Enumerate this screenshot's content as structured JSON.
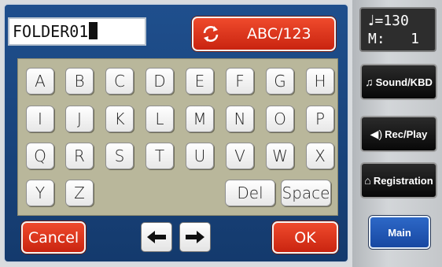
{
  "name_field": {
    "value": "FOLDER01"
  },
  "mode_button": {
    "label": "ABC/123",
    "icon": "cycle-arrows-icon"
  },
  "keyboard": {
    "rows": [
      [
        "A",
        "B",
        "C",
        "D",
        "E",
        "F",
        "G",
        "H"
      ],
      [
        "I",
        "J",
        "K",
        "L",
        "M",
        "N",
        "O",
        "P"
      ],
      [
        "Q",
        "R",
        "S",
        "T",
        "U",
        "V",
        "W",
        "X"
      ],
      [
        "Y",
        "Z"
      ]
    ],
    "del_label": "Del",
    "space_label": "Space"
  },
  "bottom_bar": {
    "cancel_label": "Cancel",
    "ok_label": "OK",
    "left_arrow": "🡐",
    "right_arrow": "🡒"
  },
  "tempo": {
    "note_symbol": "♩",
    "tempo_line": "=130",
    "measure_line": "M:   1"
  },
  "sidebar": {
    "items": [
      {
        "label": "Sound/KBD",
        "icon": "music-note-icon",
        "glyph": "♫"
      },
      {
        "label": "Rec/Play",
        "icon": "speaker-icon",
        "glyph": "◀)"
      },
      {
        "label": "Registration",
        "icon": "book-icon",
        "glyph": "⌂"
      }
    ],
    "main_label": "Main"
  },
  "colors": {
    "panel_blue": "#1a4580",
    "accent_red": "#d9321a",
    "keyboard_bg": "#b9b79b",
    "main_button_blue": "#2158b4"
  }
}
